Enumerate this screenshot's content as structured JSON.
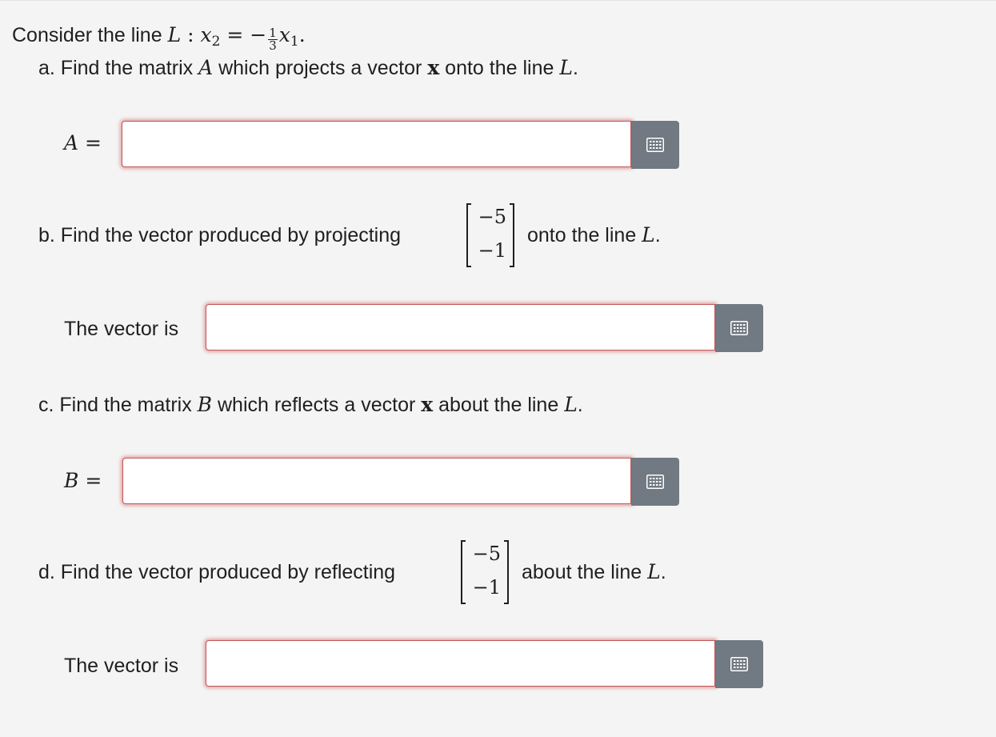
{
  "intro": {
    "prefix": "Consider the line ",
    "L": "L",
    "colon": " : ",
    "x": "x",
    "sub2": "2",
    "eq": " = −",
    "frac_num": "1",
    "frac_den": "3",
    "sub1": "1",
    "end": "."
  },
  "part_a": {
    "prefix": "a. Find the matrix ",
    "var": "A",
    "mid": " which projects a vector ",
    "vec": "x",
    "suffix": " onto the line ",
    "L": "L",
    "end": "."
  },
  "answer_a": {
    "label_var": "A",
    "label_eq": " =",
    "value": "",
    "placeholder": ""
  },
  "part_b": {
    "prefix": "b. Find the vector produced by projecting",
    "vector": [
      "−5",
      "−1"
    ],
    "suffix": "onto the line ",
    "L": "L",
    "end": "."
  },
  "answer_b": {
    "label": "The vector is",
    "value": ""
  },
  "part_c": {
    "prefix": "c. Find the matrix ",
    "var": "B",
    "mid": " which reflects a vector ",
    "vec": "x",
    "suffix": " about the line ",
    "L": "L",
    "end": "."
  },
  "answer_c": {
    "label_var": "B",
    "label_eq": " =",
    "value": ""
  },
  "part_d": {
    "prefix": "d. Find the vector produced by reflecting",
    "vector": [
      "−5",
      "−1"
    ],
    "suffix": "about the line ",
    "L": "L",
    "end": "."
  },
  "answer_d": {
    "label": "The vector is",
    "value": ""
  },
  "icons": {
    "matrix_button": "matrix-keyboard-icon"
  },
  "colors": {
    "field_border": "#c05a5a",
    "button_bg": "#717982",
    "page_bg": "#f4f4f4"
  }
}
